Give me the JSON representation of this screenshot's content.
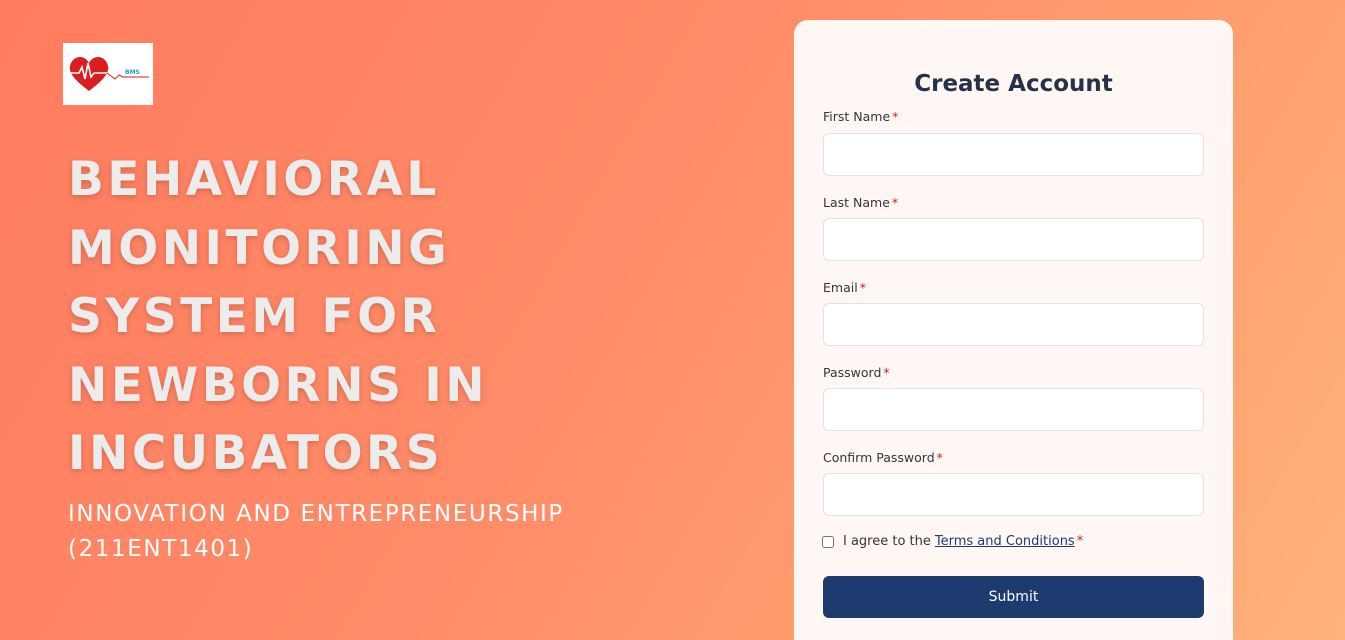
{
  "logo": {
    "icon": "heart-pulse-icon",
    "text": "BMS",
    "heart_color": "#d81e1e",
    "text_color": "#1aa1b4"
  },
  "hero": {
    "title": "BEHAVIORAL MONITORING SYSTEM FOR NEWBORNS IN INCUBATORS",
    "subtitle": "INNOVATION AND ENTREPRENEURSHIP (211ENT1401)"
  },
  "form": {
    "title": "Create Account",
    "required_marker": "*",
    "fields": [
      {
        "label": "First Name",
        "value": "",
        "placeholder": ""
      },
      {
        "label": "Last Name",
        "value": "",
        "placeholder": ""
      },
      {
        "label": "Email",
        "value": "",
        "placeholder": ""
      },
      {
        "label": "Password",
        "value": "",
        "placeholder": ""
      },
      {
        "label": "Confirm Password",
        "value": "",
        "placeholder": ""
      }
    ],
    "agree_text": "I agree to the",
    "terms_link": "Terms and Conditions",
    "terms_checked": false,
    "submit_label": "Submit"
  },
  "colors": {
    "background_start": "#ff7c5f",
    "background_end": "#ffb27b",
    "card_bg": "#fff7f4",
    "primary": "#1e3b6f",
    "required": "#d0201d",
    "title_text": "#263248"
  }
}
